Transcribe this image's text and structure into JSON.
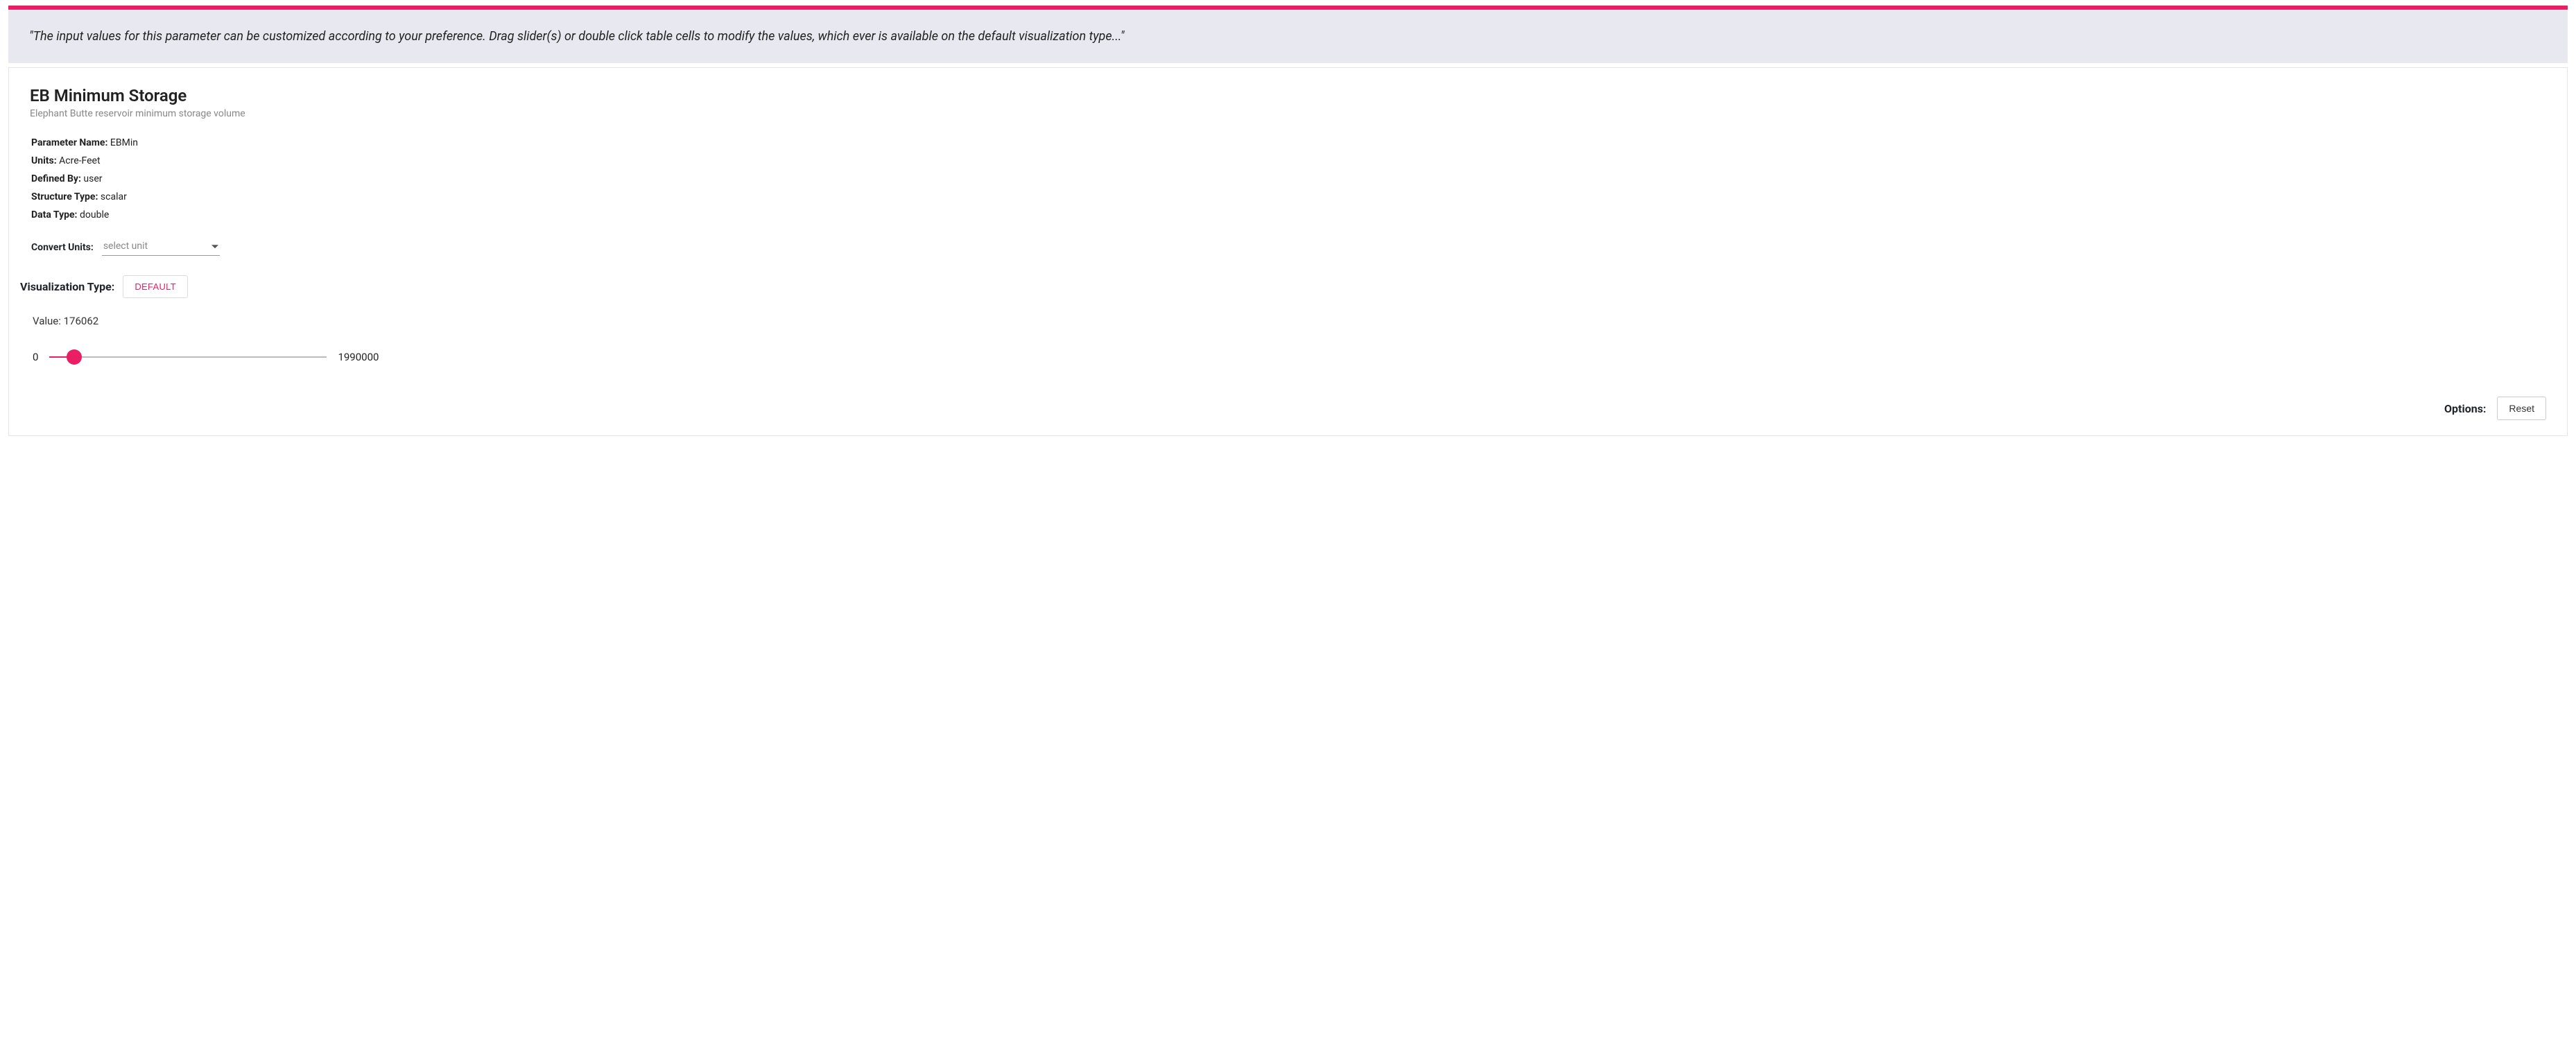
{
  "banner": {
    "text": "\"The input values for this parameter can be customized according to your preference. Drag slider(s) or double click table cells to modify the values, which ever is available on the default visualization type...\""
  },
  "card": {
    "title": "EB Minimum Storage",
    "subtitle": "Elephant Butte reservoir minimum storage volume"
  },
  "meta": {
    "parameter_name_label": "Parameter Name:",
    "parameter_name_value": "EBMin",
    "units_label": "Units:",
    "units_value": "Acre-Feet",
    "defined_by_label": "Defined By:",
    "defined_by_value": "user",
    "structure_type_label": "Structure Type:",
    "structure_type_value": "scalar",
    "data_type_label": "Data Type:",
    "data_type_value": "double"
  },
  "convert": {
    "label": "Convert Units:",
    "placeholder": "select unit"
  },
  "vis": {
    "label": "Visualization Type:",
    "button": "Default"
  },
  "slider": {
    "value_prefix": "Value: ",
    "value": "176062",
    "min": "0",
    "max": "1990000",
    "percent": 8.85
  },
  "options": {
    "label": "Options:",
    "reset": "Reset"
  }
}
